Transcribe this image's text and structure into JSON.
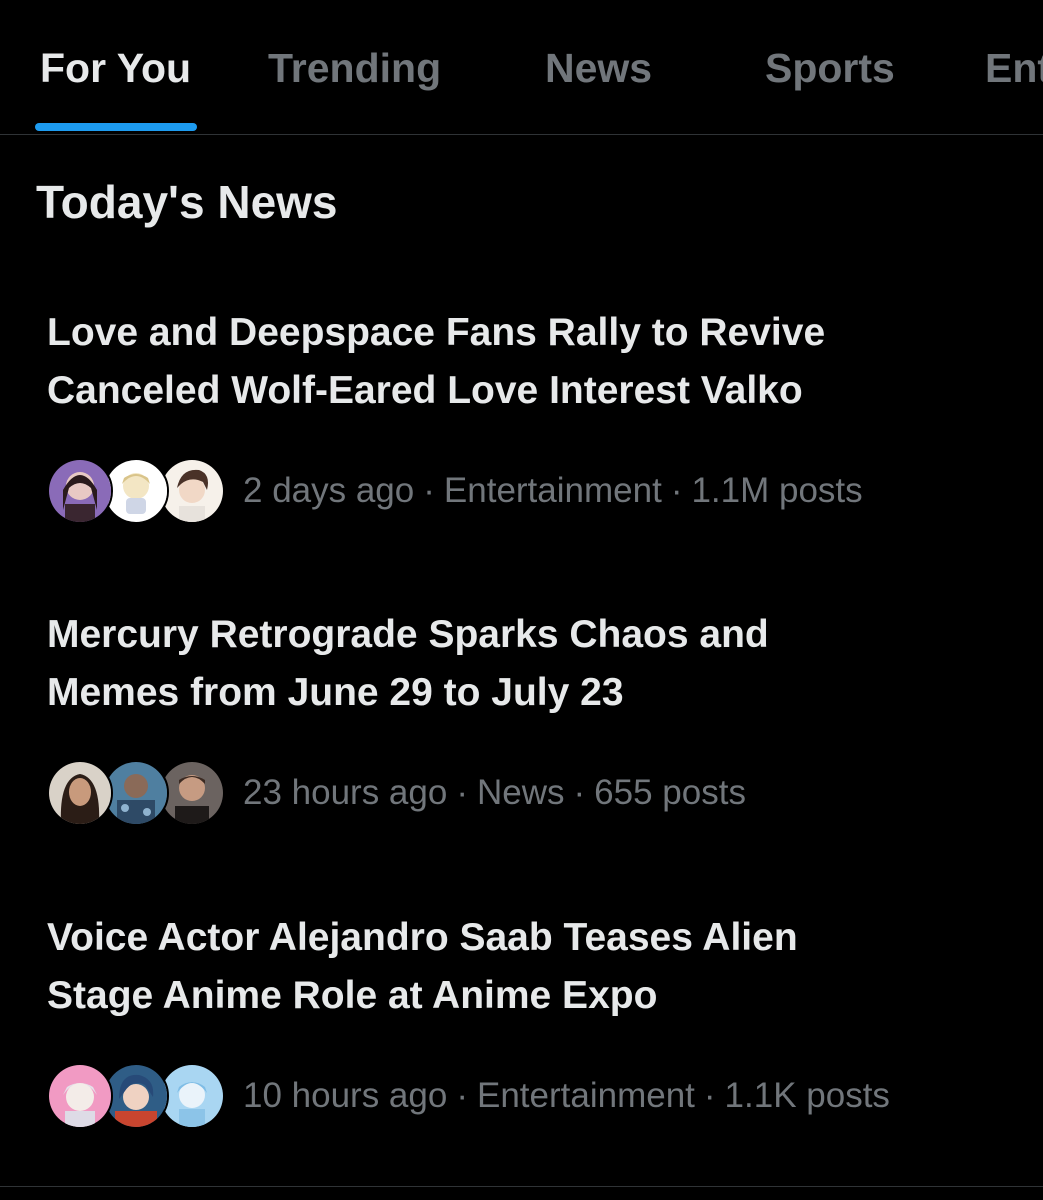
{
  "tabs": [
    {
      "label": "For You",
      "active": true
    },
    {
      "label": "Trending",
      "active": false
    },
    {
      "label": "News",
      "active": false
    },
    {
      "label": "Sports",
      "active": false
    },
    {
      "label": "Ent",
      "active": false
    }
  ],
  "section_title": "Today's News",
  "stories": [
    {
      "title_line1": "Love and Deepspace Fans Rally to Revive",
      "title_line2": "Canceled Wolf-Eared Love Interest Valko",
      "time": "2 days ago",
      "category": "Entertainment",
      "posts": "1.1M posts",
      "separator": "·",
      "avatars": [
        "anime-girl-avatar",
        "chibi-character-avatar",
        "anime-boy-avatar"
      ]
    },
    {
      "title_line1": "Mercury Retrograde Sparks Chaos and",
      "title_line2": "Memes from June 29 to July 23",
      "time": "23 hours ago",
      "category": "News",
      "posts": "655 posts",
      "separator": "·",
      "avatars": [
        "woman-avatar",
        "person-avatar",
        "man-avatar"
      ]
    },
    {
      "title_line1": "Voice Actor Alejandro Saab Teases Alien",
      "title_line2": "Stage Anime Role at Anime Expo",
      "time": "10 hours ago",
      "category": "Entertainment",
      "posts": "1.1K posts",
      "separator": "·",
      "avatars": [
        "pink-anime-avatar",
        "blue-hair-avatar",
        "light-blue-avatar"
      ]
    }
  ],
  "colors": {
    "background": "#000000",
    "primary_text": "#e7e9ea",
    "secondary_text": "#71767b",
    "accent": "#1d9bf0",
    "divider": "#2f3336"
  }
}
